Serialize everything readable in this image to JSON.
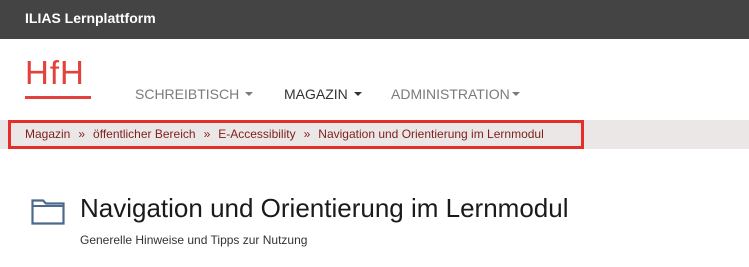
{
  "header": {
    "app_title": "ILIAS Lernplattform"
  },
  "logo": {
    "text": "HfH"
  },
  "nav": {
    "items": [
      {
        "label": "SCHREIBTISCH"
      },
      {
        "label": "MAGAZIN"
      },
      {
        "label": "ADMINISTRATION"
      }
    ]
  },
  "breadcrumb": {
    "items": [
      "Magazin",
      "öffentlicher Bereich",
      "E-Accessibility",
      "Navigation und Orientierung im Lernmodul"
    ],
    "separator": "»"
  },
  "page": {
    "title": "Navigation und Orientierung im Lernmodul",
    "subtitle": "Generelle Hinweise und Tipps zur Nutzung",
    "icon": "folder-icon"
  },
  "colors": {
    "topbar": "#444444",
    "brand": "#e2423b",
    "breadcrumb_bg": "#ece7e7",
    "breadcrumb_text": "#7d1f1a",
    "highlight_border": "#e52e28",
    "folder_icon": "#4b6a8e"
  }
}
